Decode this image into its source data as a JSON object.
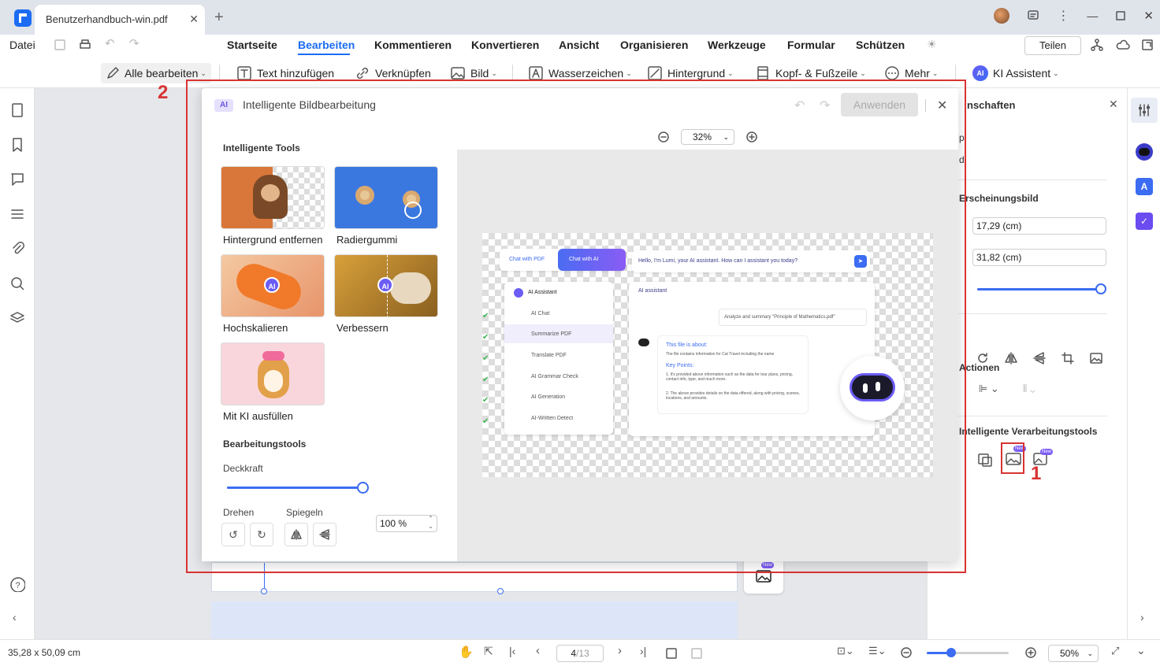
{
  "tab": {
    "title": "Benutzerhandbuch-win.pdf"
  },
  "menu": {
    "datei": "Datei",
    "items": [
      "Startseite",
      "Bearbeiten",
      "Kommentieren",
      "Konvertieren",
      "Ansicht",
      "Organisieren",
      "Werkzeuge",
      "Formular",
      "Schützen"
    ],
    "active": "Bearbeiten",
    "share": "Teilen"
  },
  "toolbar": {
    "edit_all": "Alle bearbeiten",
    "add_text": "Text hinzufügen",
    "link": "Verknüpfen",
    "image": "Bild",
    "watermark": "Wasserzeichen",
    "background": "Hintergrund",
    "header_footer": "Kopf- & Fußzeile",
    "more": "Mehr",
    "ai": "KI Assistent",
    "ai_badge": "AI"
  },
  "dialog": {
    "badge": "AI",
    "title": "Intelligente Bildbearbeitung",
    "apply": "Anwenden",
    "section_tools": "Intelligente Tools",
    "tools": [
      "Hintergrund entfernen",
      "Radiergummi",
      "Hochskalieren",
      "Verbessern",
      "Mit KI ausfüllen"
    ],
    "tool_badge": "AI",
    "section_edit": "Bearbeitungstools",
    "opacity_label": "Deckkraft",
    "opacity_value": "100 %",
    "opacity_level": 1.0,
    "rotate_label": "Drehen",
    "mirror_label": "Spiegeln",
    "zoom": "32%"
  },
  "preview": {
    "chat_pdf": "Chat with PDF",
    "chat_ai": "Chat with AI",
    "greeting": "Hello, I'm Lumi, your AI assistant. How can I assistant you today?",
    "menu_title": "AI Assistant",
    "menu_items": [
      "AI Chat",
      "Summarize PDF",
      "Translate PDF",
      "AI Grammar Check",
      "AI Generation",
      "AI-Written Detect"
    ],
    "panel_title": "AI assistant",
    "request": "Analyze and summary \"Principle of Mathematics.pdf\"",
    "about": "This file is about:",
    "about_line": "The file contains information for Cat Travel including the name",
    "key_points": "Key Points:",
    "point1": "1. It's provided above information such as the data for tour plans, pricing, contact info, type, and much more.",
    "point2": "2. The above provides details on the data offered, along with pricing, scenes, locations, and amounts."
  },
  "rightpanel": {
    "title": "nschaften",
    "p": "p",
    "d": "d",
    "appearance": "Erscheinungsbild",
    "width": "17,29 (cm)",
    "height": "31,82 (cm)",
    "actions": "Actionen",
    "smart_tools": "Intelligente Verarbeitungstools",
    "new_tag": "New"
  },
  "annotations": {
    "one": "1",
    "two": "2"
  },
  "status": {
    "dimensions": "35,28 x 50,09 cm",
    "page_current": "4",
    "page_total": "/13",
    "zoom": "50%",
    "zoom_level": 0.3
  }
}
